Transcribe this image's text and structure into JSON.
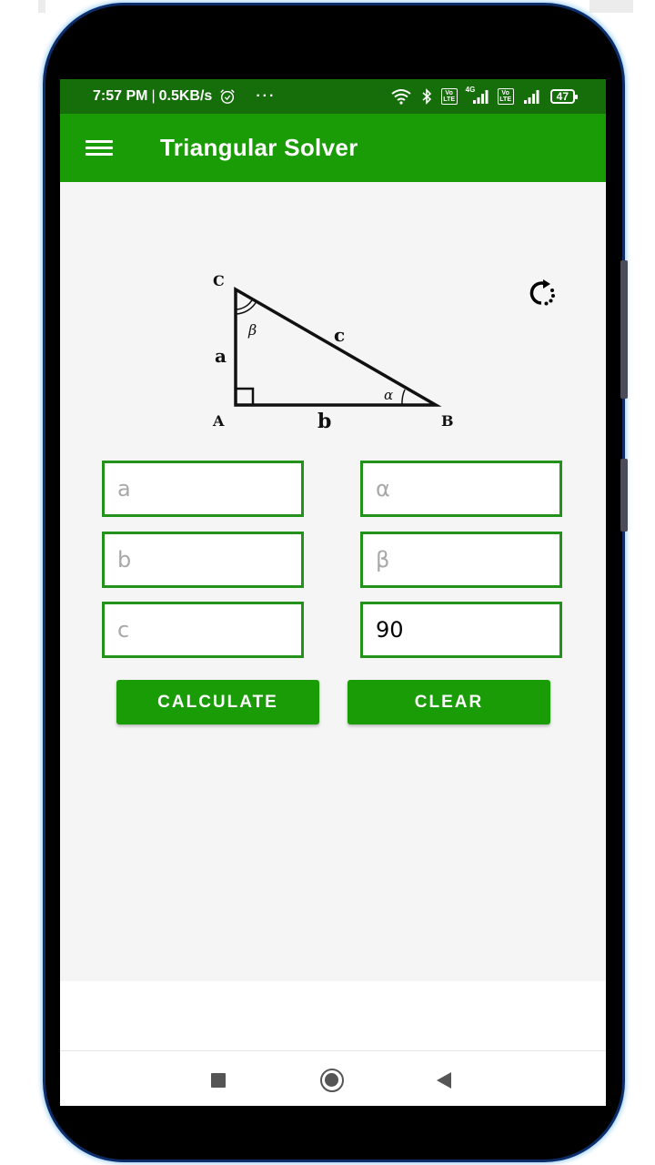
{
  "status_bar": {
    "time": "7:57 PM",
    "separator": "|",
    "net_speed": "0.5KB/s",
    "more": "···",
    "network_type": "4G",
    "volte_label_top": "Vo",
    "volte_label_bottom": "LTE",
    "battery_level": "47",
    "icons": [
      "alarm-icon",
      "more-icon",
      "wifi-icon",
      "bluetooth-icon",
      "volte-icon",
      "signal-icon",
      "volte-icon",
      "signal-icon",
      "battery-icon"
    ]
  },
  "app_bar": {
    "title": "Triangular Solver",
    "menu_icon": "menu-icon"
  },
  "diagram": {
    "vertices": {
      "A": "A",
      "B": "B",
      "C": "C"
    },
    "sides": {
      "a": "a",
      "b": "b",
      "c": "c"
    },
    "angles": {
      "alpha": "α",
      "beta": "β"
    }
  },
  "refresh": {
    "icon": "refresh-icon"
  },
  "inputs": {
    "a": {
      "placeholder": "a",
      "value": ""
    },
    "b": {
      "placeholder": "b",
      "value": ""
    },
    "c": {
      "placeholder": "c",
      "value": ""
    },
    "alpha": {
      "placeholder": "α",
      "value": ""
    },
    "beta": {
      "placeholder": "β",
      "value": ""
    },
    "gamma": {
      "placeholder": "",
      "value": "90"
    }
  },
  "buttons": {
    "calculate": "CALCULATE",
    "clear": "CLEAR"
  },
  "nav_bar": {
    "recent": "recent-apps-icon",
    "home": "home-icon",
    "back": "back-icon"
  },
  "colors": {
    "status_bar": "#166e0b",
    "app_bar": "#1a9c07",
    "field_border": "#23921a",
    "background": "#f5f5f5"
  }
}
